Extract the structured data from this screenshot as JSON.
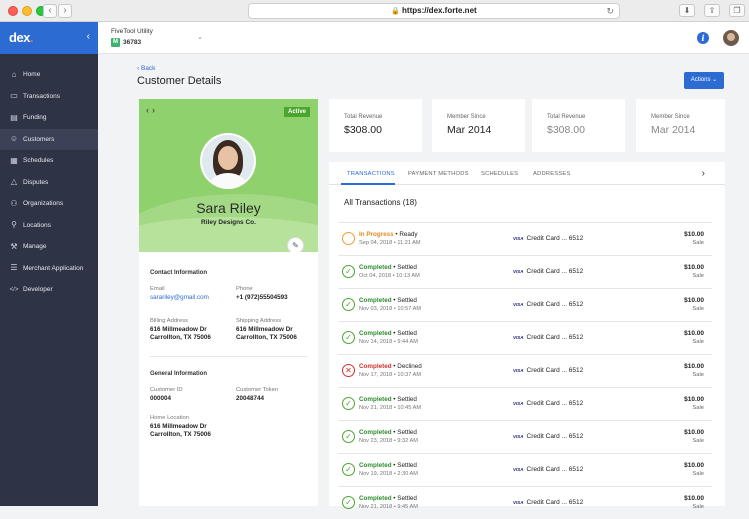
{
  "browser": {
    "url": "https://dex.forte.net"
  },
  "sidebar": {
    "logo": "dex",
    "items": [
      {
        "label": "Home",
        "icon": "home-icon"
      },
      {
        "label": "Transactions",
        "icon": "credit-card-icon"
      },
      {
        "label": "Funding",
        "icon": "bank-icon"
      },
      {
        "label": "Customers",
        "icon": "people-icon"
      },
      {
        "label": "Schedules",
        "icon": "calendar-icon"
      },
      {
        "label": "Disputes",
        "icon": "warning-icon"
      },
      {
        "label": "Organizations",
        "icon": "org-icon"
      },
      {
        "label": "Locations",
        "icon": "location-pin-icon"
      },
      {
        "label": "Manage",
        "icon": "gavel-icon"
      },
      {
        "label": "Merchant Application",
        "icon": "form-icon"
      },
      {
        "label": "Developer",
        "icon": "code-icon"
      }
    ],
    "active_index": 3
  },
  "topbar": {
    "merchant_name": "FiveTool Utility",
    "merchant_badge": "M",
    "merchant_id": "36783"
  },
  "header": {
    "back": "Back",
    "title": "Customer Details",
    "actions": "Actions"
  },
  "profile": {
    "status": "Active",
    "name": "Sara Riley",
    "company": "Riley Designs Co."
  },
  "contact": {
    "title": "Contact Information",
    "email_label": "Email",
    "email": "sarariley@gmail.com",
    "phone_label": "Phone",
    "phone": "+1 (972)55504593",
    "billing_label": "Billing Address",
    "billing_1": "616 Millmeadow Dr",
    "billing_2": "Carrollton, TX 75006",
    "shipping_label": "Shipping Address",
    "shipping_1": "616 Millmeadow Dr",
    "shipping_2": "Carrollton, TX 75006"
  },
  "general": {
    "title": "General Information",
    "customer_id_label": "Customer ID",
    "customer_id": "000004",
    "token_label": "Customer Token",
    "token": "20048744",
    "location_label": "Home Location",
    "location_1": "616 Millmeadow Dr",
    "location_2": "Carrollton, TX 75006"
  },
  "stats": [
    {
      "label": "Total Revenue",
      "value": "$308.00"
    },
    {
      "label": "Member Since",
      "value": "Mar 2014"
    },
    {
      "label": "Total Revenue",
      "value": "$308.00"
    },
    {
      "label": "Member Since",
      "value": "Mar 2014"
    }
  ],
  "tabs": [
    "TRANSACTIONS",
    "PAYMENT METHODS",
    "SCHEDULES",
    "ADDRESSES"
  ],
  "transactions_title": "All Transactions (18)",
  "colors": {
    "accent": "#2c6bd1",
    "sidebar": "#2e3446",
    "profile_green": "#8fd16c",
    "success": "#4aa62f",
    "warning": "#f39c34",
    "danger": "#d0312d"
  },
  "transactions": [
    {
      "status1": "In Progress",
      "status2": "Ready",
      "date": "Sep 04, 2018 • 11:21 AM",
      "card_brand": "VISA",
      "card": "Credit Card ... 6512",
      "amount": "$10.00",
      "type": "Sale",
      "kind": "progress"
    },
    {
      "status1": "Completed",
      "status2": "Settled",
      "date": "Oct 04, 2018 • 10:13 AM",
      "card_brand": "VISA",
      "card": "Credit Card ... 6512",
      "amount": "$10.00",
      "type": "Sale",
      "kind": "completed"
    },
    {
      "status1": "Completed",
      "status2": "Settled",
      "date": "Nov 03, 2018 • 10:57 AM",
      "card_brand": "VISA",
      "card": "Credit Card ... 6512",
      "amount": "$10.00",
      "type": "Sale",
      "kind": "completed"
    },
    {
      "status1": "Completed",
      "status2": "Settled",
      "date": "Nov 14, 2018 • 9:44 AM",
      "card_brand": "VISA",
      "card": "Credit Card ... 6512",
      "amount": "$10.00",
      "type": "Sale",
      "kind": "completed"
    },
    {
      "status1": "Completed",
      "status2": "Declined",
      "date": "Nov 17, 2018 • 10:37 AM",
      "card_brand": "VISA",
      "card": "Credit Card ... 6512",
      "amount": "$10.00",
      "type": "Sale",
      "kind": "declined"
    },
    {
      "status1": "Completed",
      "status2": "Settled",
      "date": "Nov 21, 2018 • 10:45 AM",
      "card_brand": "VISA",
      "card": "Credit Card ... 6512",
      "amount": "$10.00",
      "type": "Sale",
      "kind": "completed"
    },
    {
      "status1": "Completed",
      "status2": "Settled",
      "date": "Nov 23, 2018 • 9:32 AM",
      "card_brand": "VISA",
      "card": "Credit Card ... 6512",
      "amount": "$10.00",
      "type": "Sale",
      "kind": "completed"
    },
    {
      "status1": "Completed",
      "status2": "Settled",
      "date": "Nov 19, 2018 • 2:30 AM",
      "card_brand": "VISA",
      "card": "Credit Card ... 6512",
      "amount": "$10.00",
      "type": "Sale",
      "kind": "completed"
    },
    {
      "status1": "Completed",
      "status2": "Settled",
      "date": "Nov 21, 2018 • 9:45 AM",
      "card_brand": "VISA",
      "card": "Credit Card ... 6512",
      "amount": "$10.00",
      "type": "Sale",
      "kind": "completed"
    }
  ]
}
